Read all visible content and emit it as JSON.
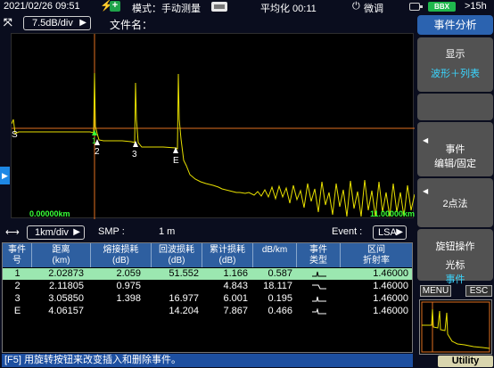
{
  "status": {
    "datetime": "2021/02/26 09:51",
    "mode": "模式：手动测量",
    "avg": "平均化 00:11",
    "fine": "微调",
    "battery": "BBX",
    "time_left": ">15h"
  },
  "header": {
    "vscale": "7.5dB/div",
    "filename_label": "文件名："
  },
  "graph": {
    "x_start": "0.00000km",
    "x_end": "11.00000km",
    "markers": [
      "S",
      "1",
      "2",
      "3",
      "E"
    ]
  },
  "hscale": {
    "scale": "1km/div",
    "smp_label": "SMP :",
    "smp_value": "1 m",
    "event_label": "Event :",
    "event_value": "LSA"
  },
  "table": {
    "columns": [
      [
        "事件",
        "号"
      ],
      [
        "距离",
        "(km)"
      ],
      [
        "熔接损耗",
        "(dB)"
      ],
      [
        "回波损耗",
        "(dB)"
      ],
      [
        "累计损耗",
        "(dB)"
      ],
      [
        "dB/km",
        ""
      ],
      [
        "事件",
        "类型"
      ],
      [
        "区间",
        "折射率"
      ]
    ],
    "rows": [
      {
        "no": "1",
        "dist": "2.02873",
        "splice": "2.059",
        "reflect": "51.552",
        "cumul": "1.166",
        "dbkm": "0.587",
        "type": "reflective",
        "ior": "1.46000",
        "selected": true
      },
      {
        "no": "2",
        "dist": "2.11805",
        "splice": "0.975",
        "reflect": "",
        "cumul": "4.843",
        "dbkm": "18.117",
        "type": "non-reflective",
        "ior": "1.46000",
        "selected": false
      },
      {
        "no": "3",
        "dist": "3.05850",
        "splice": "1.398",
        "reflect": "16.977",
        "cumul": "6.001",
        "dbkm": "0.195",
        "type": "reflective",
        "ior": "1.46000",
        "selected": false
      },
      {
        "no": "E",
        "dist": "4.06157",
        "splice": "",
        "reflect": "14.204",
        "cumul": "7.867",
        "dbkm": "0.466",
        "type": "end",
        "ior": "1.46000",
        "selected": false
      }
    ]
  },
  "footer": "[F5] 用旋转按钮来改变插入和删除事件。",
  "panel": {
    "title": "事件分析",
    "display_label": "显示",
    "display_value": "波形＋列表",
    "event_line1": "事件",
    "event_line2": "编辑/固定",
    "two_point": "2点法",
    "knob_line1": "旋钮操作",
    "knob_line2": "光标",
    "knob_line3": "事件",
    "menu": "MENU",
    "esc": "ESC",
    "utility": "Utility"
  },
  "colors": {
    "trace": "#e8e000",
    "cursor": "#e07020",
    "selected_row": "#9be7b0",
    "header_blue": "#2e5fa0"
  }
}
